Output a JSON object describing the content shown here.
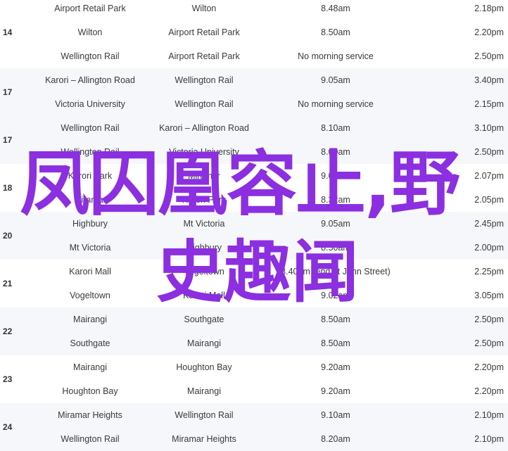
{
  "groups": [
    {
      "route": "14",
      "alt": false,
      "rows": [
        {
          "from": "Airport Retail Park",
          "to": "Wilton",
          "morning": "8.48am",
          "afternoon": "2.18pm"
        },
        {
          "from": "Wilton",
          "to": "Airport Retail Park",
          "morning": "8.50am",
          "afternoon": "2.20pm"
        },
        {
          "from": "Wellington Rail",
          "to": "Airport Retail Park",
          "morning": "No morning service",
          "afternoon": "2.50pm"
        }
      ]
    },
    {
      "route": "17",
      "alt": true,
      "rows": [
        {
          "from": "Karori – Allington Road",
          "to": "Wellington Rail",
          "morning": "9.05am",
          "afternoon": "3.40pm"
        },
        {
          "from": "Victoria University",
          "to": "Wellington Rail",
          "morning": "No morning service",
          "afternoon": "2.15pm"
        }
      ]
    },
    {
      "route": "17",
      "alt": true,
      "rows": [
        {
          "from": "Wellington Rail",
          "to": "Karori – Allington Road",
          "morning": "8.10am",
          "afternoon": "3.10pm"
        },
        {
          "from": "Wellington Rail",
          "to": "Victoria University",
          "morning": "8.00am",
          "afternoon": "2.50pm"
        }
      ]
    },
    {
      "route": "18",
      "alt": false,
      "rows": [
        {
          "from": "Karori Park",
          "to": "Miramar",
          "morning": "9.09am",
          "afternoon": "2.07pm"
        },
        {
          "from": "Miramar",
          "to": "Karori Park",
          "morning": "8.32am",
          "afternoon": "2.05pm"
        }
      ]
    },
    {
      "route": "20",
      "alt": true,
      "rows": [
        {
          "from": "Highbury",
          "to": "Mt Victoria",
          "morning": "9.05am",
          "afternoon": "2.45pm"
        },
        {
          "from": "Mt Victoria",
          "to": "Highbury",
          "morning": "8.50am",
          "afternoon": "2.00pm"
        }
      ]
    },
    {
      "route": "21",
      "alt": false,
      "rows": [
        {
          "from": "Karori Mall",
          "to": "Vogeltown",
          "morning": "8.40am (end at John Street)",
          "afternoon": "2.25pm"
        },
        {
          "from": "Vogeltown",
          "to": "Karori Mall",
          "morning": "9.02am",
          "afternoon": "3.05pm"
        }
      ]
    },
    {
      "route": "22",
      "alt": true,
      "rows": [
        {
          "from": "Mairangi",
          "to": "Southgate",
          "morning": "8.50am",
          "afternoon": "2.50pm"
        },
        {
          "from": "Southgate",
          "to": "Mairangi",
          "morning": "8.50am",
          "afternoon": "2.50pm"
        }
      ]
    },
    {
      "route": "23",
      "alt": false,
      "rows": [
        {
          "from": "Mairangi",
          "to": "Houghton Bay",
          "morning": "9.20am",
          "afternoon": "2.20pm"
        },
        {
          "from": "Houghton Bay",
          "to": "Mairangi",
          "morning": "9.20am",
          "afternoon": "2.20pm"
        }
      ]
    },
    {
      "route": "24",
      "alt": true,
      "rows": [
        {
          "from": "Miramar Heights",
          "to": "Wellington Rail",
          "morning": "9.10am",
          "afternoon": "2.10pm"
        },
        {
          "from": "Wellington Rail",
          "to": "Miramar Heights",
          "morning": "8.20am",
          "afternoon": "2.10pm"
        }
      ]
    }
  ],
  "overlay": {
    "line1": "凤囚凰容止,野",
    "line2": "史趣闻",
    "color": "#8b2fe0"
  }
}
